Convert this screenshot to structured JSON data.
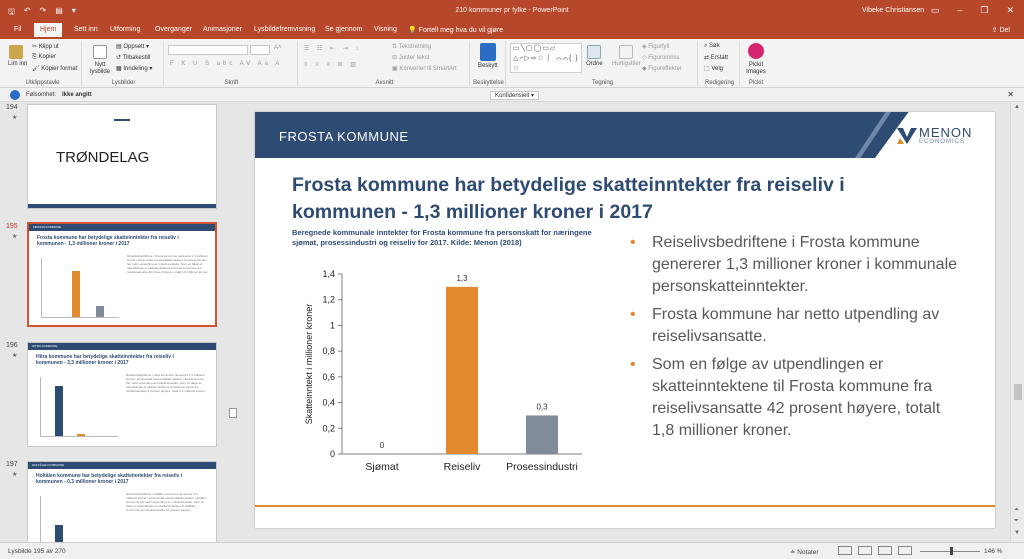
{
  "window": {
    "title": "210 kommuner pr fylke - PowerPoint",
    "user": "Vibeke Christiansen",
    "accent": "#b7472a"
  },
  "tabs": [
    {
      "label": "Fil"
    },
    {
      "label": "Hjem"
    },
    {
      "label": "Sett inn"
    },
    {
      "label": "Utforming"
    },
    {
      "label": "Overganger"
    },
    {
      "label": "Animasjoner"
    },
    {
      "label": "Lysbildefremvisning"
    },
    {
      "label": "Se gjennom"
    },
    {
      "label": "Visning"
    },
    {
      "label": "Fortell meg hva du vil gjøre"
    }
  ],
  "share_label": "Del",
  "ribbon": {
    "clipboard": {
      "paste": "Lim inn",
      "cut": "Klipp ut",
      "copy": "Kopier",
      "format_painter": "Kopier format",
      "group": "Utklippstavle"
    },
    "slides": {
      "new_slide": "Nytt lysbilde",
      "layout": "Oppsett",
      "reset": "Tilbakestill",
      "section": "Inndeling",
      "group": "Lysbilder"
    },
    "font": {
      "group": "Skrift"
    },
    "paragraph": {
      "text_direction": "Tekstretning",
      "align_text": "Juster tekst",
      "smartart": "Konverter til SmartArt",
      "group": "Avsnitt"
    },
    "protect": {
      "label": "Beskytt",
      "group": "Beskyttelse"
    },
    "drawing": {
      "shapes_glyphs": "▭╲▢◯▭▱ △⌐▷⇨☆ ⎸⌒⌒{ }☆",
      "arrange": "Ordne",
      "quick_styles": "Hurtigstiler",
      "fill": "Figurfyll",
      "outline": "Figuromriss",
      "effects": "Figureffekter",
      "group": "Tegning"
    },
    "editing": {
      "find": "Søk",
      "replace": "Erstatt",
      "select": "Velg",
      "group": "Redigering"
    },
    "pickit": {
      "label": "Pickit Images",
      "group": "Pickit"
    }
  },
  "infobar": {
    "label": "Følsomhet:",
    "value": "Ikke angitt",
    "classification": "Konfidensielt"
  },
  "thumbnails": [
    {
      "number": "194",
      "label": "TRØNDELAG"
    },
    {
      "number": "195",
      "band": "FROSTA KOMMUNE",
      "title": "Frosta kommune har betydelige skatteinntekter fra reiseliv i kommunen - 1,3 millioner kroner i 2017",
      "bullets": "Reiselivsbedriftene i Frosta kommune genererer 1,3 millioner kroner i kommunale personskatteinntekter. Frosta kommune har netto utpendling av reiselivsansatte. Som en følge av utpendlingen er skatteinntektene til Frosta kommune fra reiselivsansatte 42 prosent høyere, totalt 1,8 millioner kroner."
    },
    {
      "number": "196",
      "band": "HITRA KOMMUNE",
      "title": "Hitra kommune har betydelige skatteinntekter fra reiseliv i kommunen - 3,3 millioner kroner i 2017",
      "bullets": "Reiselivsbedriftene i Hitra kommune genererer 3,3 millioner kroner i kommunale personskatteinntekter. Hitra kommune har netto utpendling av reiselivsansatte. Som en følge av utpendlingen er skatteinntektene til Hitra kommune fra reiselivsansatte 5 prosent høyere, totalt 3,4 millioner kroner."
    },
    {
      "number": "197",
      "band": "HOLTÅLEN KOMMUNE",
      "title": "Holtålen kommune har betydelige skatteinntekter fra reiseliv i kommunen - 0,3 millioner kroner i 2017",
      "bullets": "Reiselivsbedriftene i Holtålen kommune genererer 0,3 millioner kroner i kommunale personskatteinntekter. Holtålen kommune har netto utpendling av reiselivsansatte. Som en følge av utpendlingen er skatteinntektene til Holtålen kommune fra reiselivsansatte 52 prosent høyere."
    }
  ],
  "slide": {
    "municipality": "FROSTA KOMMUNE",
    "logo_brand": "MENON",
    "logo_sub": "ECONOMICS",
    "title": "Frosta kommune har betydelige skatteinntekter fra reiseliv i kommunen - 1,3 millioner kroner i 2017",
    "caption": "Beregnede kommunale inntekter for Frosta kommune fra personskatt for næringene sjømat, prosessindustri og reiseliv for 2017. Kilde: Menon (2018)",
    "bullets": [
      "Reiselivsbedriftene i Frosta kommune genererer 1,3 millioner kroner i kommunale personskatteinntekter.",
      "Frosta kommune har netto utpendling av reiselivsansatte.",
      "Som en følge av utpendlingen er skatteinntektene til Frosta kommune fra reiselivsansatte 42 prosent høyere, totalt 1,8 millioner kroner."
    ],
    "colors": {
      "navy": "#2e4b73",
      "orange": "#e08a2d",
      "gray": "#808c99"
    }
  },
  "chart_data": {
    "type": "bar",
    "categories": [
      "Sjømat",
      "Reiseliv",
      "Prosessindustri"
    ],
    "values": [
      0,
      1.3,
      0.3
    ],
    "data_labels": [
      "0",
      "1,3",
      "0,3"
    ],
    "colors": [
      "#2e4b73",
      "#e08a2d",
      "#808c99"
    ],
    "ylabel": "Skatteinntekt i millioner kroner",
    "ylim": [
      0,
      1.4
    ],
    "yticks": [
      "0",
      "0,2",
      "0,4",
      "0,6",
      "0,8",
      "1",
      "1,2",
      "1,4"
    ],
    "grid": false
  },
  "status": {
    "slide_counter": "Lysbilde 195 av 270",
    "notes": "Notater",
    "zoom": "146 %"
  }
}
